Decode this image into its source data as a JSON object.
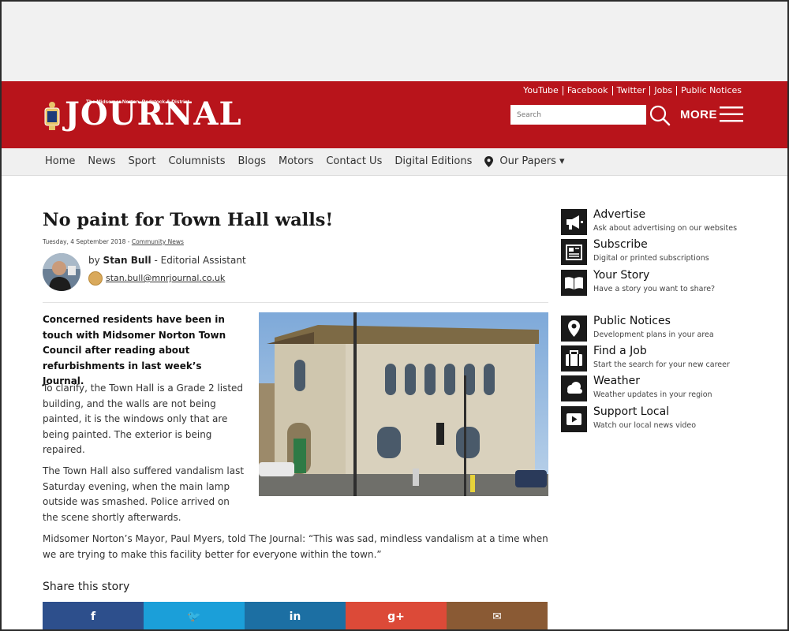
{
  "header": {
    "logo_small": "The Midsomer Norton, Radstock & District",
    "logo_big": "JOURNAL",
    "top_links": [
      "YouTube",
      "Facebook",
      "Twitter",
      "Jobs",
      "Public Notices"
    ],
    "search_placeholder": "Search",
    "more_label": "MORE"
  },
  "nav": {
    "items": [
      "Home",
      "News",
      "Sport",
      "Columnists",
      "Blogs",
      "Motors",
      "Contact Us",
      "Digital Editions"
    ],
    "our_papers": "Our Papers ▾"
  },
  "article": {
    "title": "No paint for Town Hall walls!",
    "date": "Tuesday, 4 September 2018",
    "separator": " - ",
    "category": "Community News",
    "by_prefix": "by ",
    "author": "Stan Bull",
    "author_role": " - Editorial Assistant",
    "email": "stan.bull@mnrjournal.co.uk",
    "lead": "Concerned residents have been in touch with Midsomer Norton Town Council after reading about refurbishments in last week’s Journal.",
    "paragraphs": [
      "To clarify, the Town Hall is a Grade 2 listed building, and the walls are not being painted, it is the windows only that are being painted. The exterior is being repaired.",
      "The Town Hall also suffered vandalism last Saturday evening, when the main lamp outside was smashed. Police arrived on the scene shortly afterwards.",
      "Midsomer Norton’s Mayor, Paul Myers, told The Journal: “This was sad, mindless vandalism at a time when we are trying to make this facility better for everyone within the town.”"
    ]
  },
  "share": {
    "title": "Share this story",
    "buttons": [
      {
        "label": "f",
        "color": "#2d4f8c"
      },
      {
        "label": "🐦",
        "color": "#1b9fd9"
      },
      {
        "label": "in",
        "color": "#1c6fa3"
      },
      {
        "label": "g+",
        "color": "#dc4a38"
      },
      {
        "label": "✉",
        "color": "#8a5a34"
      }
    ]
  },
  "sidebar": {
    "items": [
      {
        "title": "Advertise",
        "sub": "Ask about advertising on our websites",
        "icon": "megaphone-icon"
      },
      {
        "title": "Subscribe",
        "sub": "Digital or printed subscriptions",
        "icon": "newspaper-icon"
      },
      {
        "title": "Your Story",
        "sub": "Have a story you want to share?",
        "icon": "book-icon"
      },
      {
        "title": "Public Notices",
        "sub": "Development plans in your area",
        "icon": "map-pin-icon"
      },
      {
        "title": "Find a Job",
        "sub": "Start the search for your new career",
        "icon": "briefcase-icon"
      },
      {
        "title": "Weather",
        "sub": "Weather updates in your region",
        "icon": "cloud-icon"
      },
      {
        "title": "Support Local",
        "sub": "Watch our local news video",
        "icon": "video-icon"
      }
    ]
  }
}
